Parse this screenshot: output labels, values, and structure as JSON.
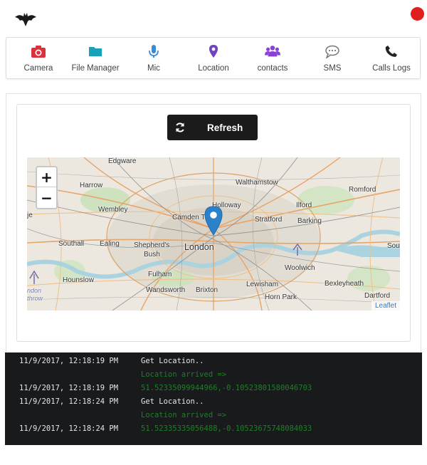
{
  "header": {
    "logo_icon": "bat-logo-icon",
    "status_color": "#e01e1e"
  },
  "nav": {
    "items": [
      {
        "label": "Camera",
        "icon": "camera-icon",
        "color": "#d9323c"
      },
      {
        "label": "File Manager",
        "icon": "folder-icon",
        "color": "#17a2b8"
      },
      {
        "label": "Mic",
        "icon": "microphone-icon",
        "color": "#3a8bd6"
      },
      {
        "label": "Location",
        "icon": "map-pin-icon",
        "color": "#6f42c1"
      },
      {
        "label": "contacts",
        "icon": "users-icon",
        "color": "#8a3fd6"
      },
      {
        "label": "SMS",
        "icon": "chat-bubble-icon",
        "color": "#777777"
      },
      {
        "label": "Calls Logs",
        "icon": "phone-icon",
        "color": "#222222"
      }
    ]
  },
  "main": {
    "refresh_label": "Refresh",
    "refresh_icon": "refresh-icon"
  },
  "map": {
    "zoom_in": "+",
    "zoom_out": "−",
    "attribution": "Leaflet",
    "labels": {
      "edgware": "Edgware",
      "harrow": "Harrow",
      "walthamstow": "Walthamstow",
      "romford": "Romford",
      "wembley": "Wembley",
      "holloway": "Holloway",
      "ilford": "Ilford",
      "camden": "Camden T",
      "stratford": "Stratford",
      "barking": "Barking",
      "southall": "Southall",
      "ealing": "Ealing",
      "shepherds": "Shepherd's",
      "bush": "Bush",
      "london": "London",
      "sou": "Sou",
      "woolwich": "Woolwich",
      "hounslow": "Hounslow",
      "fulham": "Fulham",
      "lewisham": "Lewisham",
      "bexleyheath": "Bexleyheath",
      "wandsworth": "Wandsworth",
      "brixton": "Brixton",
      "hornpark": "Horn Park",
      "dartford": "Dartford",
      "je": "je",
      "ndon": "ndon",
      "throw": "throw"
    }
  },
  "console": {
    "lines": [
      {
        "time": "11/9/2017, 12:18:19 PM",
        "message": "Get Location..",
        "green": false
      },
      {
        "time": "",
        "message": "Location arrived =>",
        "green": true
      },
      {
        "time": "11/9/2017, 12:18:19 PM",
        "message": "51.52335099944966,-0.10523801580046703",
        "green": true
      },
      {
        "time": "11/9/2017, 12:18:24 PM",
        "message": "Get Location..",
        "green": false
      },
      {
        "time": "",
        "message": "Location arrived =>",
        "green": true
      },
      {
        "time": "11/9/2017, 12:18:24 PM",
        "message": "51.52335335056488,-0.10523675748084033",
        "green": true
      }
    ]
  }
}
